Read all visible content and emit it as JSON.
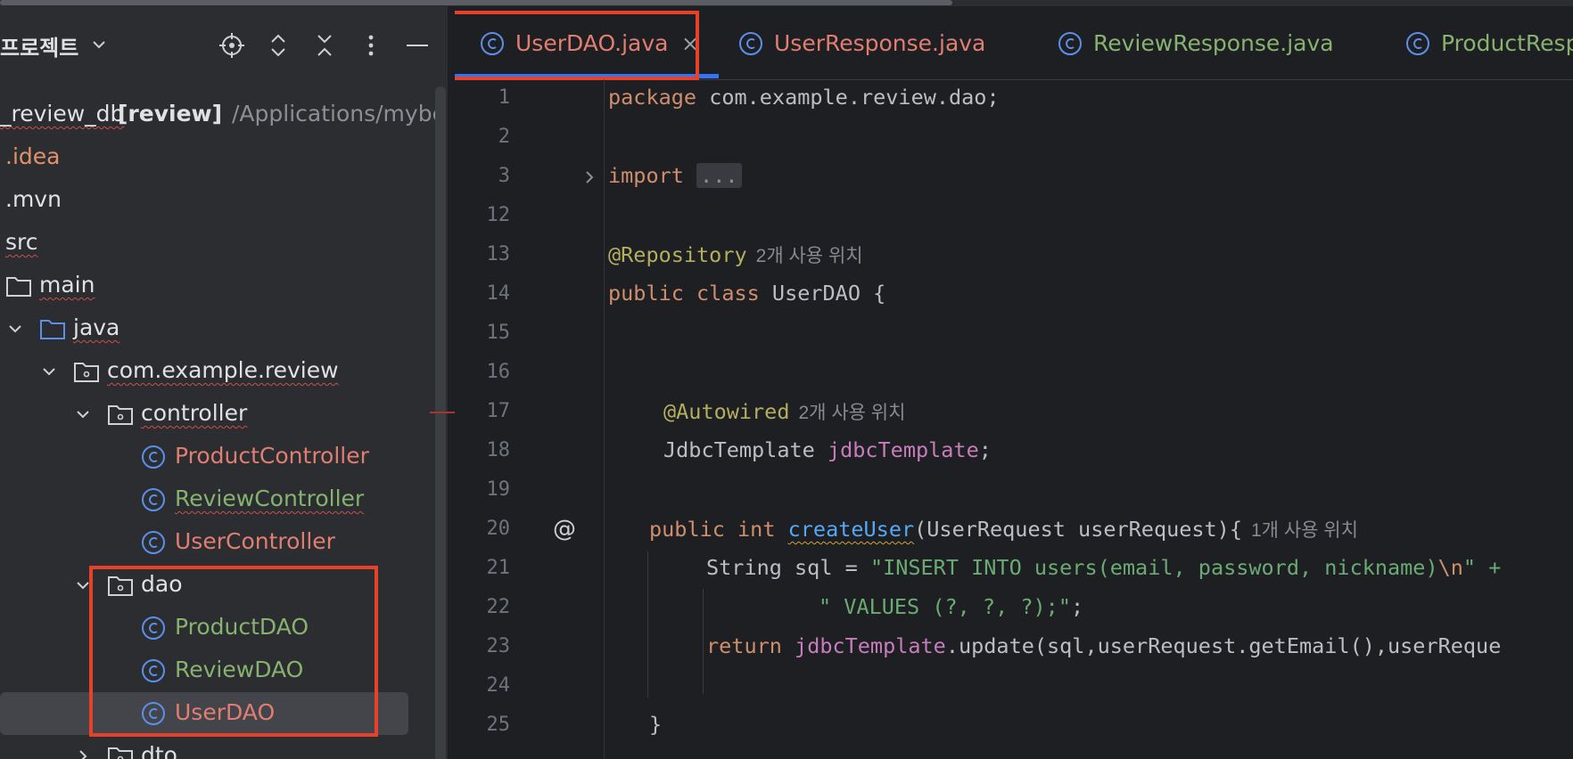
{
  "project_panel": {
    "title": "프로젝트",
    "tree": [
      {
        "label": "_review_db",
        "suffix": " [review]",
        "path": "/Applications/mybe"
      },
      {
        "label": ".idea"
      },
      {
        "label": ".mvn"
      },
      {
        "label": "src"
      },
      {
        "label": "main"
      },
      {
        "label": "java"
      },
      {
        "label": "com.example.review"
      },
      {
        "label": "controller"
      },
      {
        "label": "ProductController"
      },
      {
        "label": "ReviewController"
      },
      {
        "label": "UserController"
      },
      {
        "label": "dao"
      },
      {
        "label": "ProductDAO"
      },
      {
        "label": "ReviewDAO"
      },
      {
        "label": "UserDAO"
      },
      {
        "label": "dto"
      }
    ]
  },
  "tabs": [
    {
      "label": "UserDAO.java",
      "close": "×"
    },
    {
      "label": "UserResponse.java"
    },
    {
      "label": "ReviewResponse.java"
    },
    {
      "label": "ProductResp"
    }
  ],
  "editor": {
    "line_numbers": [
      "1",
      "2",
      "3",
      "12",
      "13",
      "14",
      "15",
      "16",
      "17",
      "18",
      "19",
      "20",
      "21",
      "22",
      "23",
      "24",
      "25"
    ],
    "code": {
      "l1_kw": "package",
      "l1_rest": " com.example.review.dao;",
      "l3_kw": "import",
      "l3_fold": "...",
      "l13_ann": "@Repository",
      "l13_hint": "2개 사용 위치",
      "l14_kw": "public class",
      "l14_rest": " UserDAO {",
      "l17_ann": "@Autowired",
      "l17_hint": "2개 사용 위치",
      "l18_type": "JdbcTemplate ",
      "l18_field": "jdbcTemplate",
      "l18_end": ";",
      "l20_kw": "public int ",
      "l20_fn": "createUser",
      "l20_rest": "(UserRequest userRequest){",
      "l20_hint": "1개 사용 위치",
      "l21_pre": "String sql = ",
      "l21_str": "\"INSERT INTO users(email, password, nickname)",
      "l21_esc": "\\n",
      "l21_str2": "\" +",
      "l22_str": "\" VALUES (?, ?, ?);\"",
      "l22_end": ";",
      "l23_kw": "return ",
      "l23_field": "jdbcTemplate",
      "l23_rest": ".update(sql,userRequest.getEmail(),userReque",
      "l25": "}",
      "at_icon": "@"
    }
  }
}
